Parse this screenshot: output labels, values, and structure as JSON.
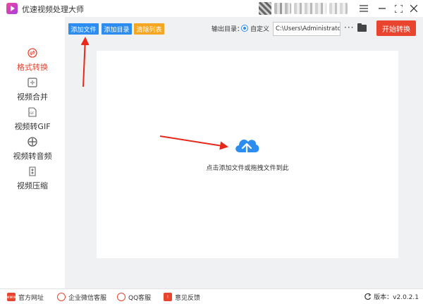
{
  "app": {
    "title": "优速视频处理大师"
  },
  "sidebar": {
    "items": [
      {
        "label": "格式转换",
        "active": true
      },
      {
        "label": "视频合并"
      },
      {
        "label": "视频转GIF"
      },
      {
        "label": "视频转音频"
      },
      {
        "label": "视频压缩"
      }
    ]
  },
  "toolbar": {
    "add_file": "添加文件",
    "add_folder": "添加目录",
    "clear_list": "清除列表",
    "output_label": "输出目录：",
    "custom_label": "自定义",
    "output_path": "C:\\Users\\Administrator\\",
    "more": "···",
    "start": "开始转换"
  },
  "drop_area": {
    "hint": "点击添加文件或拖拽文件到此"
  },
  "footer": {
    "website": "官方网址",
    "wechat": "企业微信客服",
    "qq": "QQ客服",
    "feedback": "意见反馈",
    "version": "版本：v2.0.2.1"
  },
  "colors": {
    "accent": "#e8442e",
    "primary": "#2d8cf0",
    "warning": "#f5a623",
    "cloud": "#2d8cf0"
  }
}
